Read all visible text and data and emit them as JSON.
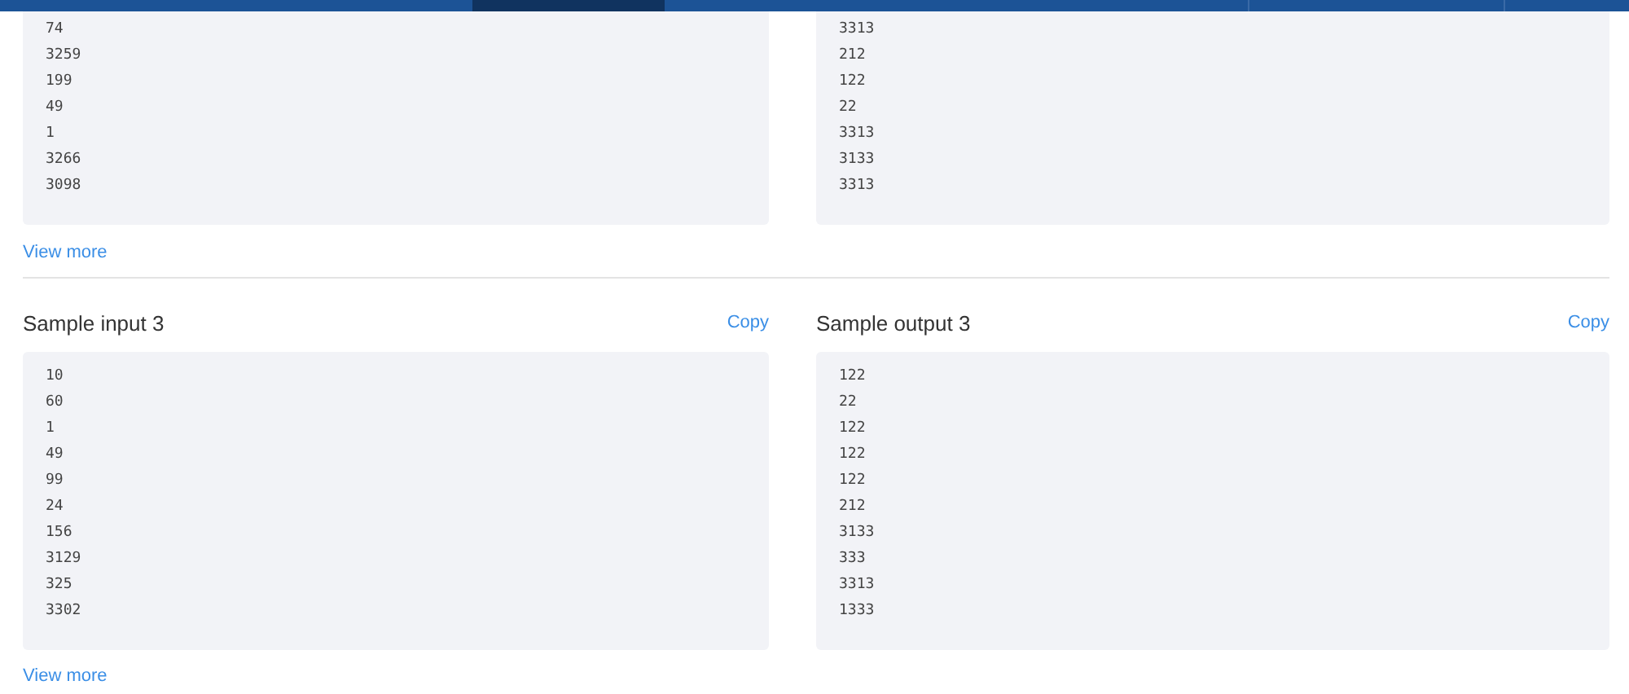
{
  "nav": [
    {
      "selected": false
    },
    {
      "selected": true
    },
    {
      "selected": false
    },
    {
      "selected": false
    },
    {
      "selected": false
    }
  ],
  "sections": [
    {
      "columns": [
        {
          "lines": [
            "74",
            "3259",
            "199",
            "49",
            "1",
            "3266",
            "3098"
          ]
        },
        {
          "lines": [
            "3313",
            "212",
            "122",
            "22",
            "3313",
            "3133",
            "3313"
          ]
        }
      ],
      "view_more": "View more"
    },
    {
      "columns": [
        {
          "title": "Sample input 3",
          "copy": "Copy",
          "lines": [
            "10",
            "60",
            "1",
            "49",
            "99",
            "24",
            "156",
            "3129",
            "325",
            "3302"
          ]
        },
        {
          "title": "Sample output 3",
          "copy": "Copy",
          "lines": [
            "122",
            "22",
            "122",
            "122",
            "122",
            "212",
            "3133",
            "333",
            "3313",
            "1333"
          ]
        }
      ],
      "view_more": "View more"
    }
  ]
}
